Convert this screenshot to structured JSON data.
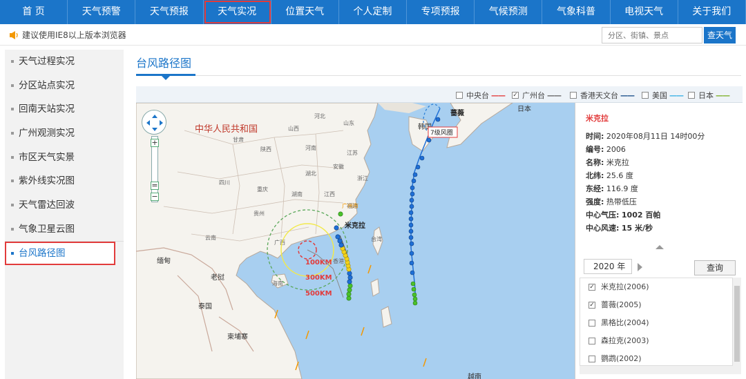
{
  "nav": {
    "items": [
      "首 页",
      "天气预警",
      "天气预报",
      "天气实况",
      "位置天气",
      "个人定制",
      "专项预报",
      "气候预测",
      "气象科普",
      "电视天气",
      "关于我们"
    ],
    "active_index": 3
  },
  "notice": {
    "text": "建议使用IE8以上版本浏览器",
    "search_placeholder": "分区、街镇、景点",
    "search_button": "查天气"
  },
  "sidebar": {
    "items": [
      "天气过程实况",
      "分区站点实况",
      "回南天站实况",
      "广州观测实况",
      "市区天气实景",
      "紫外线实况图",
      "天气雷达回波",
      "气象卫星云图",
      "台风路径图"
    ],
    "active_index": 8
  },
  "main": {
    "title": "台风路径图"
  },
  "legend": {
    "items": [
      {
        "label": "中央台",
        "checked": false,
        "color": "#e23b3b"
      },
      {
        "label": "广州台",
        "checked": true,
        "color": "#666666"
      },
      {
        "label": "香港天文台",
        "checked": false,
        "color": "#1b4f8a"
      },
      {
        "label": "美国",
        "checked": false,
        "color": "#3ab0e6"
      },
      {
        "label": "日本",
        "checked": false,
        "color": "#7fb02a"
      }
    ]
  },
  "map": {
    "country_label": "中华人民共和国",
    "other_labels": [
      "韩国",
      "日本",
      "缅甸",
      "老挝",
      "泰国",
      "柬埔寨",
      "越南",
      "海南"
    ],
    "province_labels": [
      "山西",
      "河北",
      "山东",
      "甘肃",
      "陕西",
      "河南",
      "江苏",
      "安徽",
      "湖北",
      "四川",
      "重庆",
      "浙江",
      "江西",
      "湖南",
      "贵州",
      "福建",
      "云南",
      "广西",
      "台湾",
      "香港"
    ],
    "city_label": "广州市",
    "typhoon_label": "米克拉",
    "typhoon2_label": "蔷薇",
    "wind_circle_label": "7级风圈",
    "radius_labels": [
      "100KM",
      "300KM",
      "500KM"
    ]
  },
  "info": {
    "name_title": "米克拉",
    "rows": [
      {
        "k": "时间:",
        "v": "2020年08月11日 14时00分"
      },
      {
        "k": "编号:",
        "v": "2006"
      },
      {
        "k": "名称:",
        "v": "米克拉"
      },
      {
        "k": "北纬:",
        "v": "25.6 度"
      },
      {
        "k": "东经:",
        "v": "116.9 度"
      },
      {
        "k": "强度:",
        "v": "热带低压"
      },
      {
        "k": "中心气压:",
        "v": "1002 百帕"
      },
      {
        "k": "中心风速:",
        "v": "15 米/秒"
      }
    ],
    "year": "2020 年",
    "query_button": "查询"
  },
  "typhoon_list": [
    {
      "label": "米克拉(2006)",
      "checked": true
    },
    {
      "label": "蔷薇(2005)",
      "checked": true
    },
    {
      "label": "黑格比(2004)",
      "checked": false
    },
    {
      "label": "森拉克(2003)",
      "checked": false
    },
    {
      "label": "鹦鹉(2002)",
      "checked": false
    }
  ],
  "colors": {
    "nav_bg": "#1b75c9",
    "highlight": "#e23b3b",
    "sea": "#a8cff0",
    "land": "#f5f3ee",
    "track_green": "#4ac12a",
    "track_yellow": "#f2d21a",
    "track_blue": "#1f6fd6"
  }
}
